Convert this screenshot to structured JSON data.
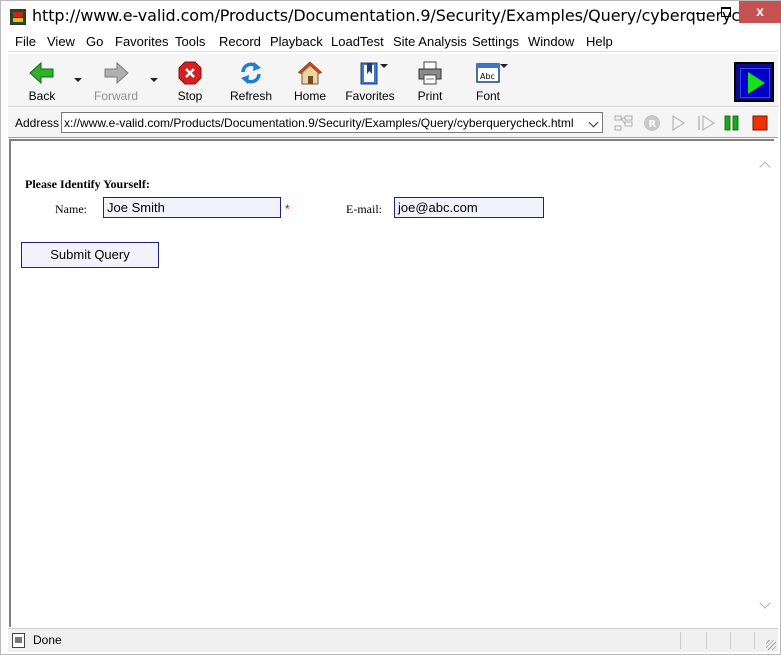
{
  "window": {
    "title": "http://www.e-valid.com/Products/Documentation.9/Security/Examples/Query/cyberquerycheck.h...",
    "close_glyph": "x"
  },
  "menu": [
    {
      "label": "File"
    },
    {
      "label": "View"
    },
    {
      "label": "Go"
    },
    {
      "label": "Favorites"
    },
    {
      "label": "Tools"
    },
    {
      "label": "Record"
    },
    {
      "label": "Playback"
    },
    {
      "label": "LoadTest"
    },
    {
      "label": "Site Analysis"
    },
    {
      "label": "Settings"
    },
    {
      "label": "Window"
    },
    {
      "label": "Help"
    }
  ],
  "toolbar": {
    "back": {
      "label": "Back",
      "icon": "back-arrow-icon"
    },
    "forward": {
      "label": "Forward",
      "icon": "forward-arrow-icon"
    },
    "stop": {
      "label": "Stop",
      "icon": "stop-icon"
    },
    "refresh": {
      "label": "Refresh",
      "icon": "refresh-icon"
    },
    "home": {
      "label": "Home",
      "icon": "home-icon"
    },
    "favorites": {
      "label": "Favorites",
      "icon": "favorites-icon"
    },
    "print": {
      "label": "Print",
      "icon": "print-icon"
    },
    "font": {
      "label": "Font",
      "icon": "font-icon",
      "icon_text": "Abc"
    }
  },
  "address": {
    "label": "Address",
    "url": "x://www.e-valid.com/Products/Documentation.9/Security/Examples/Query/cyberquerycheck.html",
    "record_badge": "R"
  },
  "page": {
    "heading": "Please Identify Yourself:",
    "name_label": "Name:",
    "name_value": "Joe Smith",
    "required_mark": "*",
    "email_label": "E-mail:",
    "email_value": "joe@abc.com",
    "submit_label": "Submit Query"
  },
  "status": {
    "text": "Done"
  },
  "colors": {
    "accent_green": "#2fb02f",
    "stop_red": "#d52020",
    "input_border": "#202080",
    "input_bg": "#f2f2fc"
  }
}
